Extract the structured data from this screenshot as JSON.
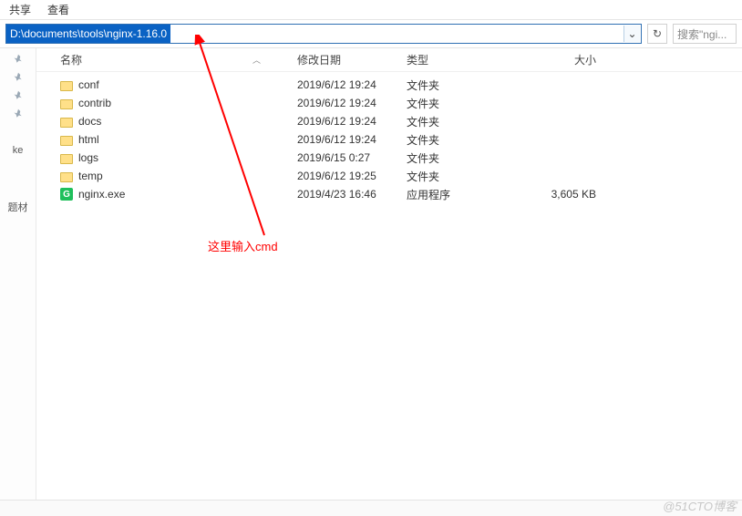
{
  "menu": {
    "share": "共享",
    "view": "查看"
  },
  "address": {
    "path": "D:\\documents\\tools\\nginx-1.16.0",
    "search_placeholder": "搜索\"ngi..."
  },
  "columns": {
    "name": "名称",
    "date": "修改日期",
    "type": "类型",
    "size": "大小"
  },
  "left": {
    "mark1": "ke",
    "mark2": "题材"
  },
  "rows": [
    {
      "icon": "folder",
      "name": "conf",
      "date": "2019/6/12 19:24",
      "type": "文件夹",
      "size": ""
    },
    {
      "icon": "folder",
      "name": "contrib",
      "date": "2019/6/12 19:24",
      "type": "文件夹",
      "size": ""
    },
    {
      "icon": "folder",
      "name": "docs",
      "date": "2019/6/12 19:24",
      "type": "文件夹",
      "size": ""
    },
    {
      "icon": "folder",
      "name": "html",
      "date": "2019/6/12 19:24",
      "type": "文件夹",
      "size": ""
    },
    {
      "icon": "folder",
      "name": "logs",
      "date": "2019/6/15 0:27",
      "type": "文件夹",
      "size": ""
    },
    {
      "icon": "folder",
      "name": "temp",
      "date": "2019/6/12 19:25",
      "type": "文件夹",
      "size": ""
    },
    {
      "icon": "exe",
      "name": "nginx.exe",
      "date": "2019/4/23 16:46",
      "type": "应用程序",
      "size": "3,605 KB"
    }
  ],
  "annotation": "这里输入cmd",
  "watermark": "@51CTO博客"
}
